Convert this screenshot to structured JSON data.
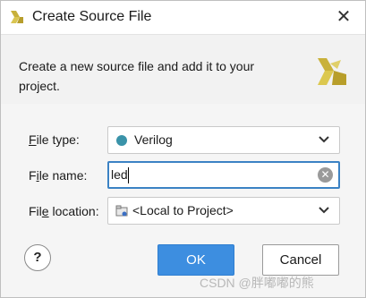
{
  "window": {
    "title": "Create Source File",
    "close_glyph": "✕"
  },
  "header": {
    "description": "Create a new source file and add it to your project."
  },
  "form": {
    "file_type": {
      "label_pre": "",
      "label_underlined": "F",
      "label_post": "ile type:",
      "value": "Verilog",
      "dot_color": "#3a93a9"
    },
    "file_name": {
      "label_pre": "F",
      "label_underlined": "i",
      "label_post": "le name:",
      "value": "led"
    },
    "file_location": {
      "label_pre": "Fil",
      "label_underlined": "e",
      "label_post": " location:",
      "value": "<Local to Project>"
    }
  },
  "buttons": {
    "help": "?",
    "ok": "OK",
    "cancel": "Cancel"
  },
  "watermark": "CSDN @胖嘟嘟的熊",
  "colors": {
    "accent": "#3d8ee0",
    "focus_border": "#3b82c4"
  }
}
